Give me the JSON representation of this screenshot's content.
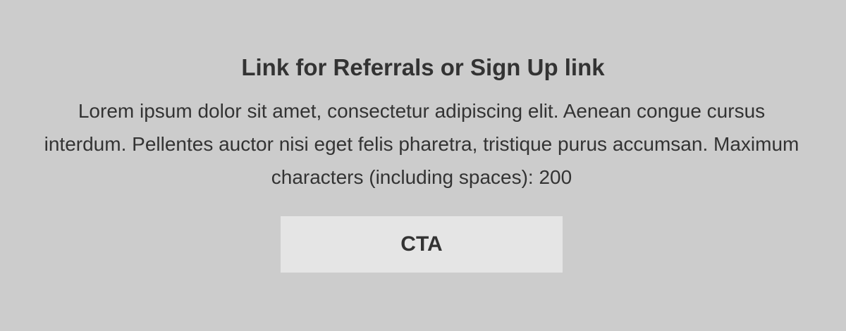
{
  "banner": {
    "headline": "Link for Referrals or Sign Up link",
    "body": "Lorem ipsum dolor sit amet, consectetur adipiscing elit. Aenean congue cursus interdum. Pellentes auctor nisi eget felis pharetra, tristique purus accumsan. Maximum characters (including spaces): 200",
    "cta_label": "CTA"
  },
  "colors": {
    "background": "#cccccc",
    "text": "#333333",
    "button_background": "#e5e5e5"
  }
}
